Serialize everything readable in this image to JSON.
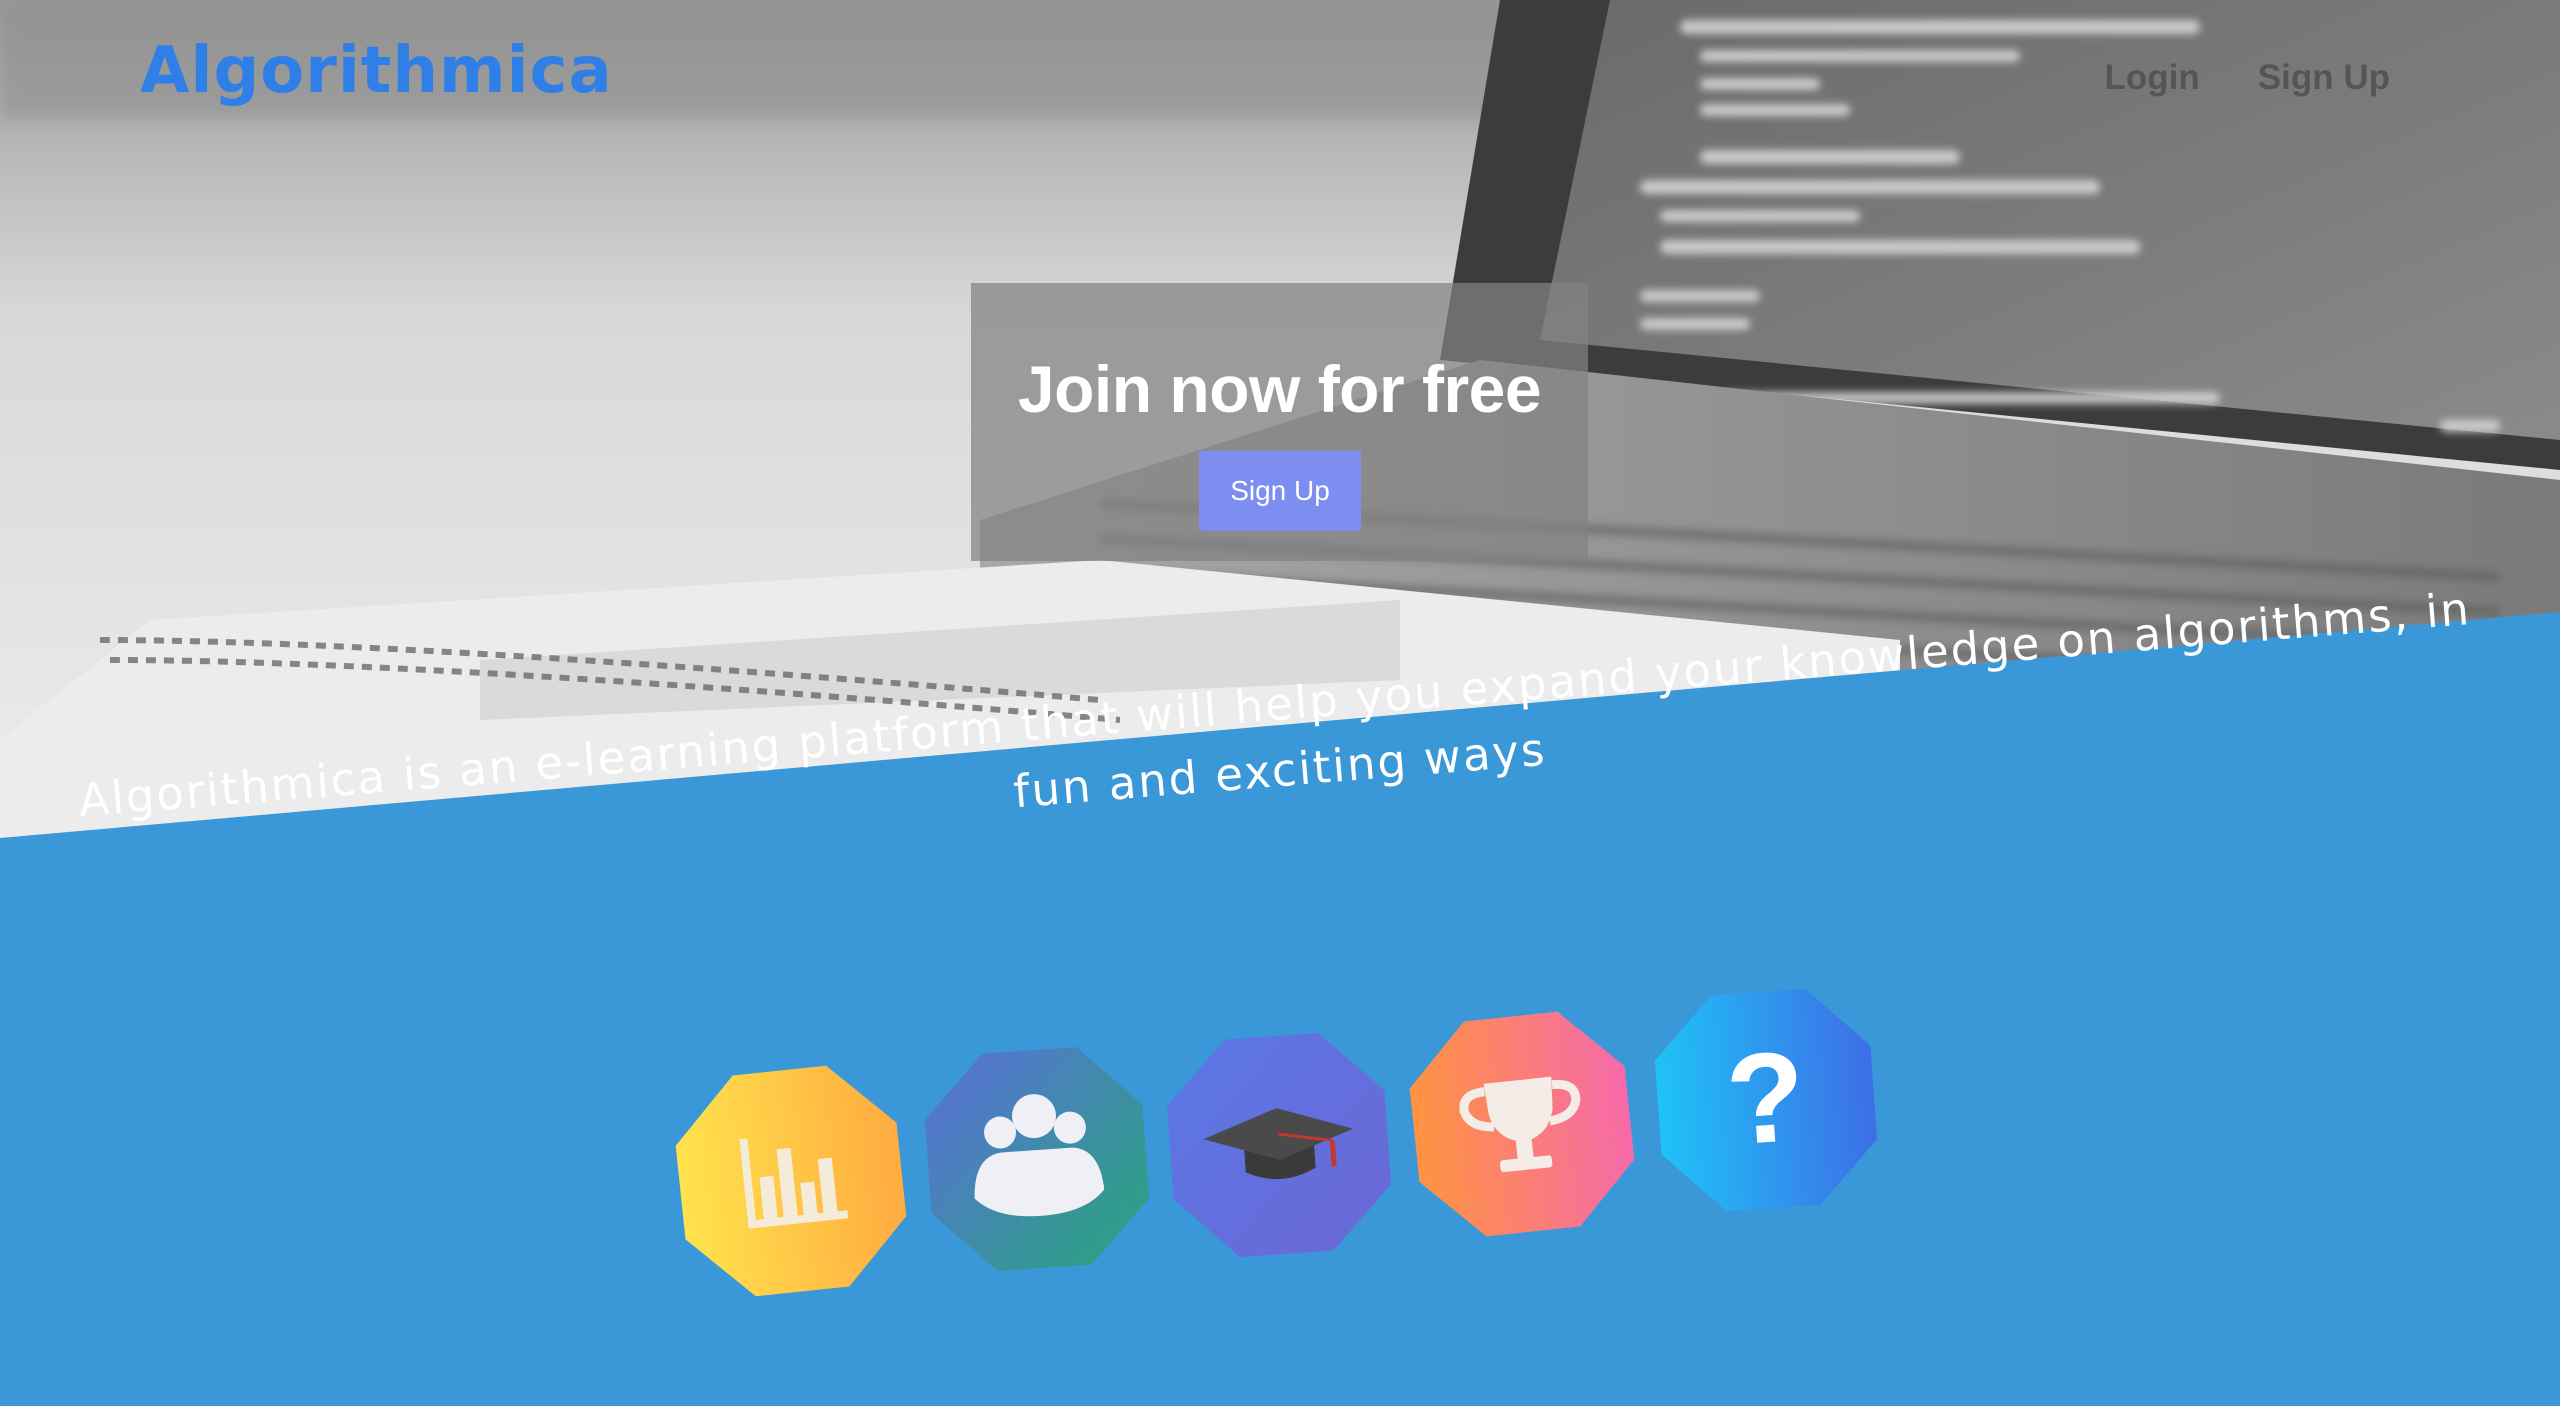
{
  "header": {
    "logo": "Algorithmica",
    "nav": [
      {
        "label": "Login"
      },
      {
        "label": "Sign Up"
      }
    ]
  },
  "hero": {
    "title": "Join now for free",
    "button_label": "Sign Up"
  },
  "tagline": "Algorithmica is an e-learning platform that will help you expand your knowledge on algorithms, in fun and exciting ways",
  "features": [
    {
      "icon": "bar-chart-icon",
      "colors": [
        "#ffe34d",
        "#ffab40"
      ]
    },
    {
      "icon": "group-icon",
      "colors": [
        "#5b6fdc",
        "#26a67a"
      ]
    },
    {
      "icon": "graduation-cap-icon",
      "colors": [
        "#5a78e6",
        "#6b67d4"
      ]
    },
    {
      "icon": "trophy-icon",
      "colors": [
        "#ff9340",
        "#f66aaa"
      ]
    },
    {
      "icon": "question-mark-icon",
      "colors": [
        "#1fc3f7",
        "#3d6ee6"
      ]
    }
  ],
  "colors": {
    "brand": "#2f7fe6",
    "section_blue": "#3a98d8",
    "cta_button": "#7c8ef0",
    "nav_text": "#555555"
  }
}
